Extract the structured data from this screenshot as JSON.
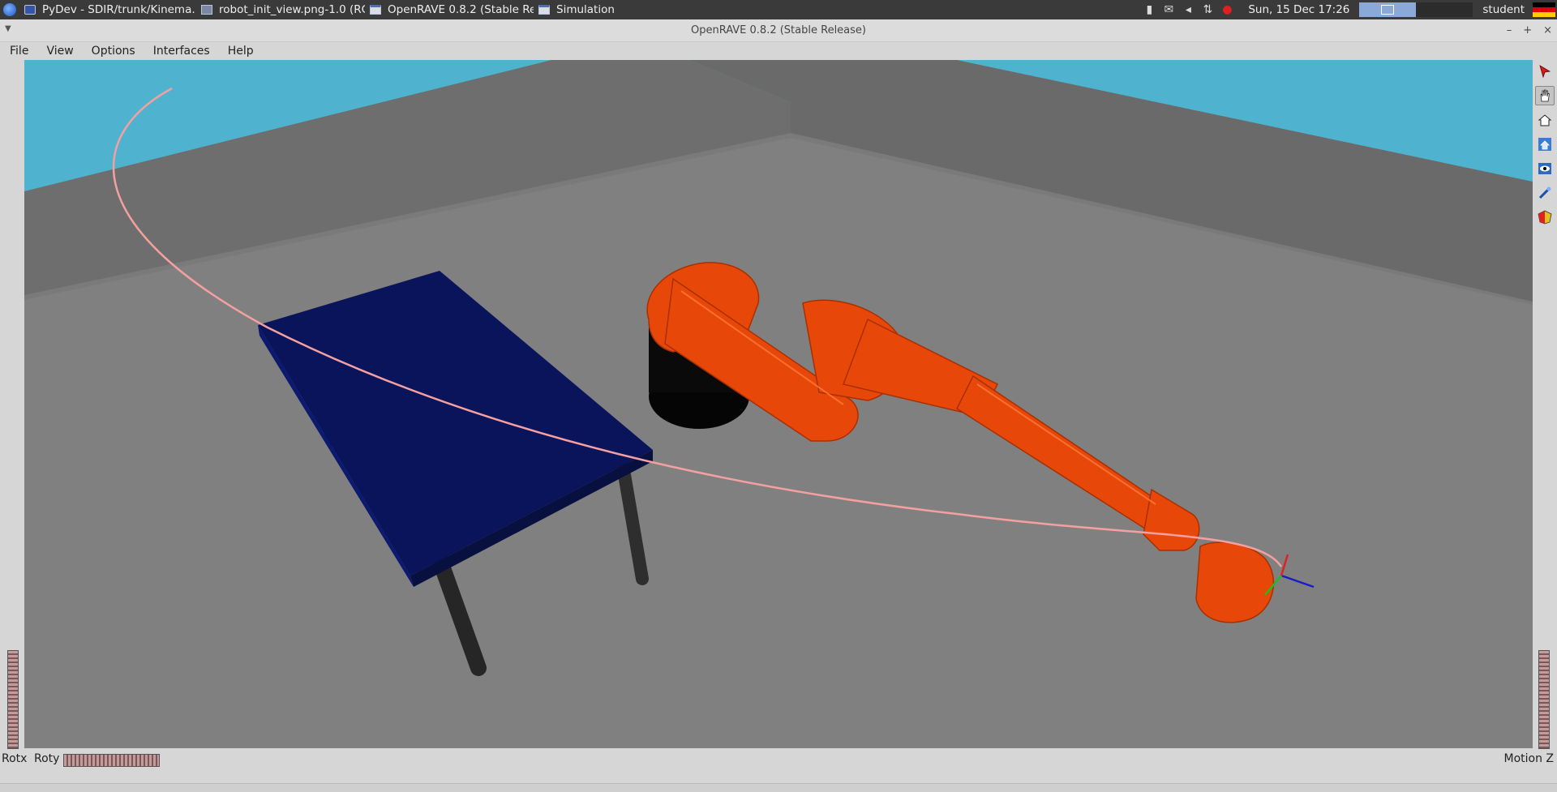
{
  "taskbar": {
    "tasks": [
      {
        "label": "PyDev - SDIR/trunk/Kinema...",
        "icon": "eclipse-icon"
      },
      {
        "label": "robot_init_view.png-1.0 (RG...",
        "icon": "image-icon"
      },
      {
        "label": "OpenRAVE 0.8.2 (Stable Rel...",
        "icon": "window-icon"
      },
      {
        "label": "Simulation",
        "icon": "window-icon"
      }
    ],
    "clock": "Sun, 15 Dec  17:26",
    "user": "student"
  },
  "window": {
    "title": "OpenRAVE 0.8.2 (Stable Release)",
    "minimize": "–",
    "maximize": "+",
    "close": "×"
  },
  "menu": {
    "file": "File",
    "view": "View",
    "options": "Options",
    "interfaces": "Interfaces",
    "help": "Help"
  },
  "toolbar": {
    "tools": [
      "select-arrow-icon",
      "pan-hand-icon",
      "home-view-icon",
      "set-home-icon",
      "view-all-icon",
      "seek-icon",
      "perspective-icon"
    ],
    "active": "pan-hand-icon"
  },
  "status": {
    "rotx": "Rotx",
    "roty": "Roty",
    "motion_z": "Motion Z"
  },
  "colors": {
    "robot": "#e8470a",
    "table": "#0a145a",
    "sky": "#4fb3cf",
    "floor": "#808080",
    "trajectory": "#f4a0a0"
  }
}
